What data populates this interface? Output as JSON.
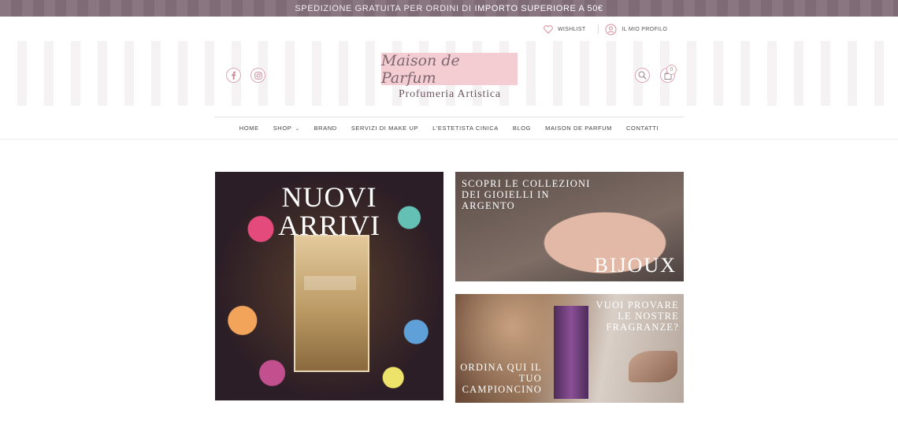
{
  "announcement": {
    "text": "SPEDIZIONE GRATUITA PER ORDINI DI",
    "highlight": "IMPORTO SUPERIORE A 50€"
  },
  "account": {
    "wishlist_label": "WISHLIST",
    "profile_label": "IL MIO PROFILO"
  },
  "logo": {
    "name": "Maison de Parfum",
    "subtitle": "Profumeria Artistica"
  },
  "social": [
    {
      "name": "facebook-icon"
    },
    {
      "name": "instagram-icon"
    }
  ],
  "cart": {
    "count": "0"
  },
  "nav": {
    "home": "HOME",
    "shop": "SHOP",
    "brand": "BRAND",
    "makeup": "SERVIZI DI MAKE UP",
    "estetista": "L'ESTETISTA CINICA",
    "blog": "BLOG",
    "maison": "MAISON DE PARFUM",
    "contatti": "CONTATTI"
  },
  "banners": {
    "new_arrivals": {
      "line1": "NUOVI",
      "line2": "ARRIVI"
    },
    "bijoux": {
      "caption": "SCOPRI LE COLLEZIONI DEI GIOIELLI IN ARGENTO",
      "title": "BIJOUX"
    },
    "fragrances": {
      "top": "VUOI PROVARE LE NOSTRE FRAGRANZE?",
      "bottom": "ORDINA QUI IL TUO CAMPIONCINO"
    }
  },
  "colors": {
    "topbar": "#8a7681",
    "accent_pink": "#dba9b5",
    "logo_bg": "#f3cdd2"
  }
}
